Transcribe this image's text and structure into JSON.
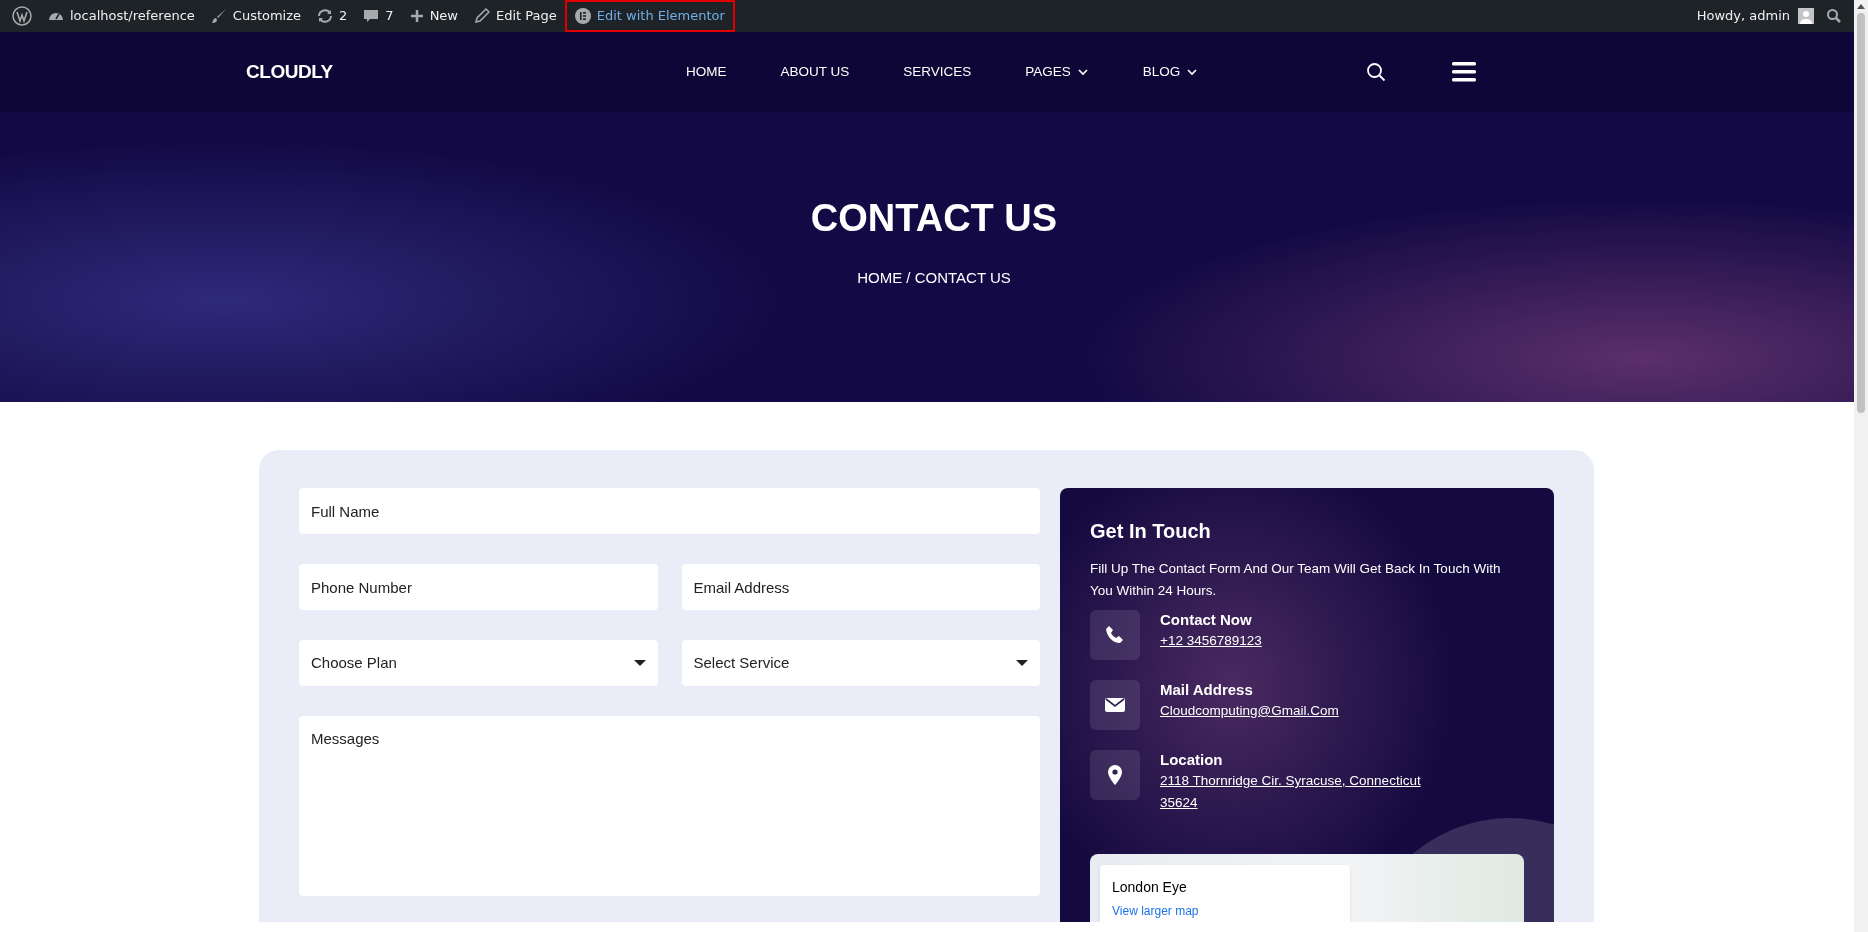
{
  "admin_bar": {
    "items": [
      {
        "kind": "wp-logo"
      },
      {
        "kind": "dashboard",
        "label": "localhost/reference",
        "highlighted": false
      },
      {
        "kind": "brush",
        "label": "Customize",
        "highlighted": false
      },
      {
        "kind": "updates",
        "label": "2",
        "highlighted": false
      },
      {
        "kind": "comments",
        "label": "7",
        "highlighted": false
      },
      {
        "kind": "plus",
        "label": "New",
        "highlighted": false
      },
      {
        "kind": "pencil",
        "label": "Edit Page",
        "highlighted": false
      },
      {
        "kind": "elementor",
        "label": "Edit with Elementor",
        "highlighted": true
      }
    ],
    "greeting": "Howdy, admin"
  },
  "header": {
    "logo": "CLOUDLY",
    "nav": [
      {
        "label": "HOME",
        "dropdown": false
      },
      {
        "label": "ABOUT US",
        "dropdown": false
      },
      {
        "label": "SERVICES",
        "dropdown": false
      },
      {
        "label": "PAGES",
        "dropdown": true
      },
      {
        "label": "BLOG",
        "dropdown": true
      }
    ]
  },
  "hero": {
    "title": "CONTACT US",
    "breadcrumb": "HOME / CONTACT US"
  },
  "form": {
    "fields": [
      {
        "kind": "wide-text",
        "placeholder": "Full Name"
      },
      {
        "kind": "text",
        "placeholder": "Phone Number"
      },
      {
        "kind": "text",
        "placeholder": "Email Address"
      },
      {
        "kind": "select",
        "placeholder": "Choose Plan"
      },
      {
        "kind": "select",
        "placeholder": "Select Service"
      },
      {
        "kind": "textarea",
        "placeholder": "Messages"
      }
    ]
  },
  "contact_card": {
    "title": "Get In Touch",
    "description": "Fill Up The Contact Form And Our Team Will Get Back In Touch With You Within 24 Hours.",
    "items": [
      {
        "kind": "phone",
        "label": "Contact Now",
        "value": "+12 3456789123"
      },
      {
        "kind": "mail",
        "label": "Mail Address",
        "value": "Cloudcomputing@Gmail.Com"
      },
      {
        "kind": "location",
        "label": "Location",
        "value": "2118 Thornridge Cir. Syracuse, Connecticut 35624"
      }
    ],
    "map": {
      "place": "London Eye",
      "link": "View larger map"
    }
  }
}
